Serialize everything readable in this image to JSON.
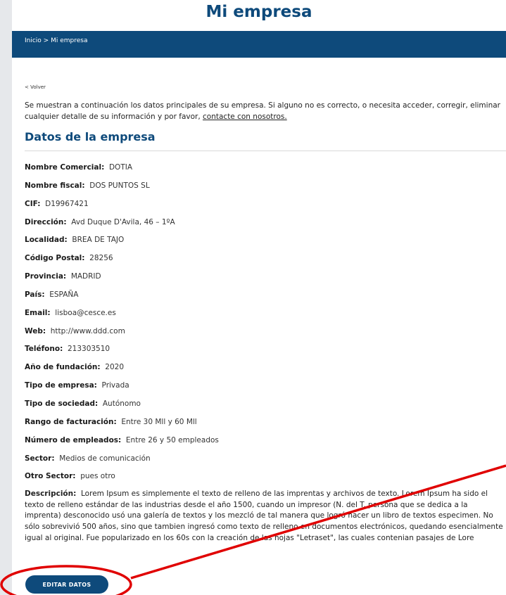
{
  "page": {
    "title": "Mi empresa"
  },
  "breadcrumb": {
    "text": "Inicio > Mi empresa"
  },
  "back_link": "< Volver",
  "intro": {
    "text": "Se muestran a continuación los datos principales de su empresa. Si alguno no es correcto, o necesita acceder, corregir, eliminar cualquier detalle de su información y por favor, ",
    "link": "contacte con nosotros."
  },
  "section_title": "Datos de la empresa",
  "fields": [
    {
      "label": "Nombre Comercial:",
      "value": "DOTIA"
    },
    {
      "label": "Nombre fiscal:",
      "value": "DOS PUNTOS SL"
    },
    {
      "label": "CIF:",
      "value": "D19967421"
    },
    {
      "label": "Dirección:",
      "value": "Avd Duque D'Avila, 46 – 1ºA"
    },
    {
      "label": "Localidad:",
      "value": "BREA DE TAJO"
    },
    {
      "label": "Código Postal:",
      "value": "28256"
    },
    {
      "label": "Provincia:",
      "value": "MADRID"
    },
    {
      "label": "País:",
      "value": "ESPAÑA"
    },
    {
      "label": "Email:",
      "value": "lisboa@cesce.es"
    },
    {
      "label": "Web:",
      "value": "http://www.ddd.com"
    },
    {
      "label": "Teléfono:",
      "value": "213303510"
    },
    {
      "label": "Año de fundación:",
      "value": "2020"
    },
    {
      "label": "Tipo de empresa:",
      "value": "Privada"
    },
    {
      "label": "Tipo de sociedad:",
      "value": "Autónomo"
    },
    {
      "label": "Rango de facturación:",
      "value": "Entre 30 Mll y 60 Mll"
    },
    {
      "label": "Número de empleados:",
      "value": "Entre 26 y 50 empleados"
    },
    {
      "label": "Sector:",
      "value": "Medios de comunicación"
    },
    {
      "label": "Otro Sector:",
      "value": "pues otro"
    }
  ],
  "description": {
    "label": "Descripción:",
    "value": "Lorem Ipsum es simplemente el texto de relleno de las imprentas y archivos de texto. Lorem Ipsum ha sido el texto de relleno estándar de las industrias desde el año 1500, cuando un impresor (N. del T. persona que se dedica a la imprenta) desconocido usó una galería de textos y los mezcló de tal manera que logró hacer un libro de textos especimen. No sólo sobrevivió 500 años, sino que tambien ingresó como texto de relleno en documentos electrónicos, quedando esencialmente igual al original. Fue popularizado en los 60s con la creación de las hojas \"Letraset\", las cuales contenian pasajes de Lore"
  },
  "edit_button": {
    "label": "EDITAR DATOS"
  },
  "colors": {
    "brand": "#0e4a7b",
    "annotation": "#e00000"
  }
}
